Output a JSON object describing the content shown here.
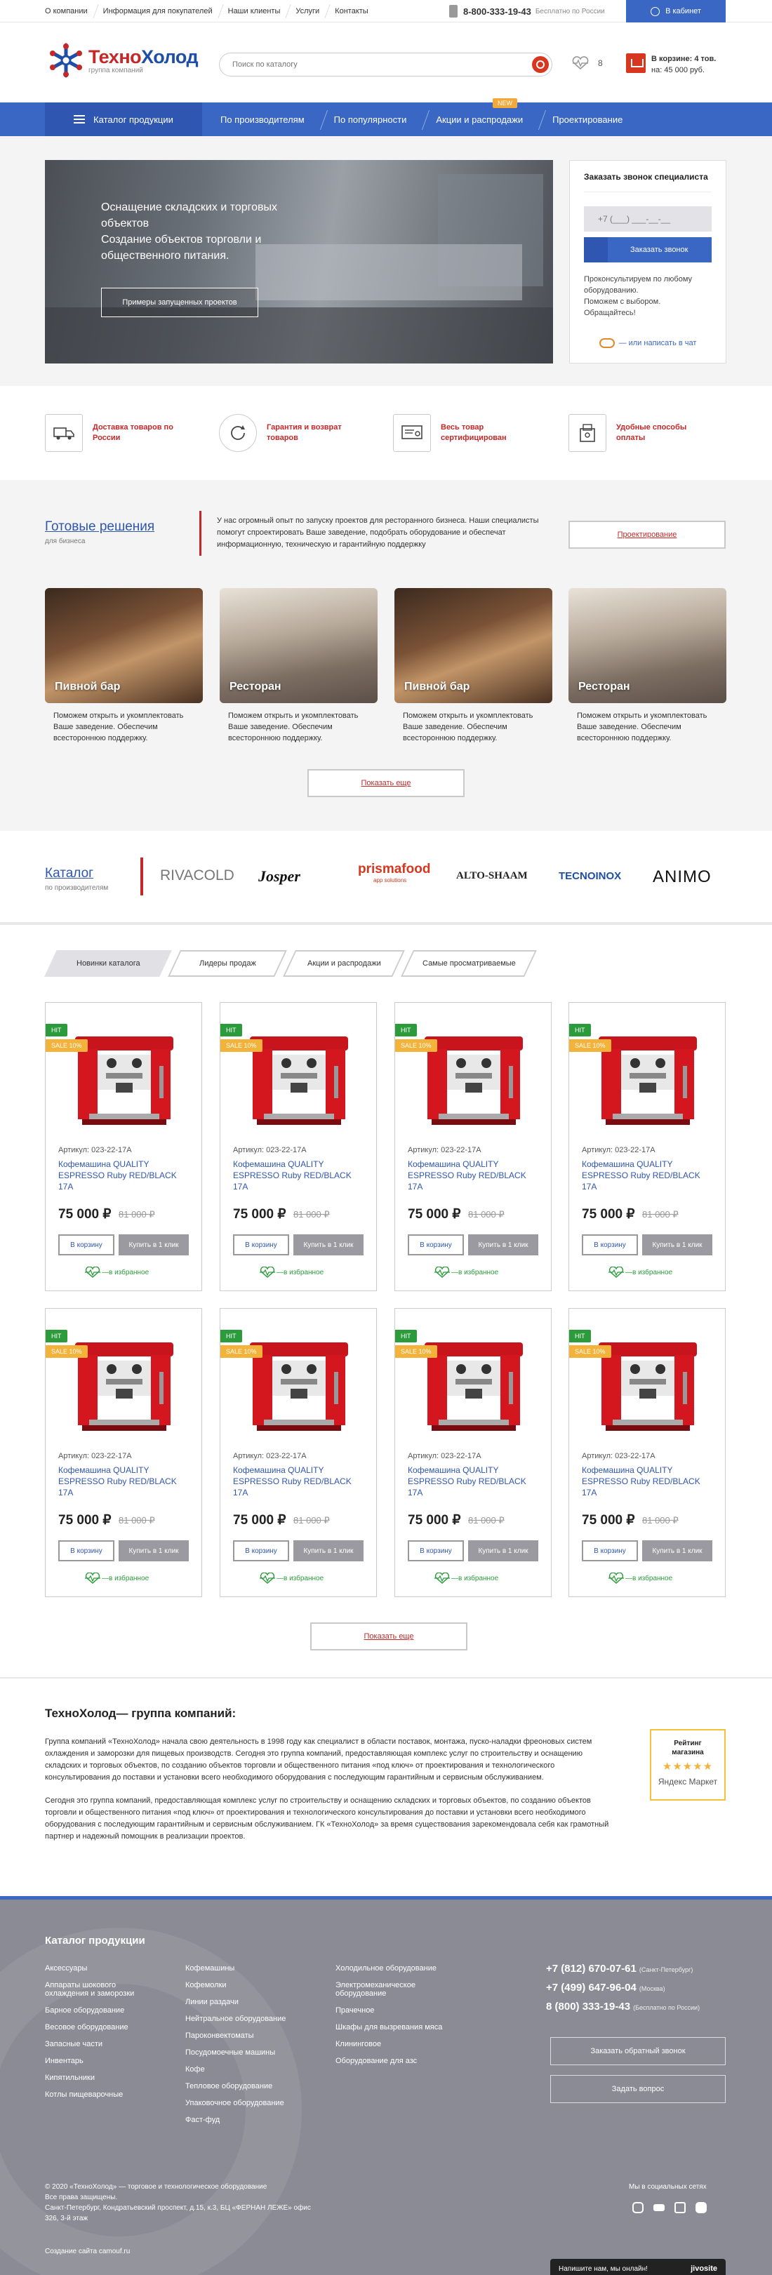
{
  "topnav": {
    "items": [
      "О компании",
      "Информация для покупателей",
      "Наши клиенты",
      "Услуги",
      "Контакты"
    ],
    "phone": "8-800-333-19-43",
    "phone_note": "Бесплатно по России",
    "cabinet": "В кабинет"
  },
  "header": {
    "logo_title_a": "Техно",
    "logo_title_b": "Холод",
    "logo_sub": "группа компаний",
    "search_placeholder": "Поиск по каталогу",
    "fav_count": "8",
    "cart_line1": "В корзине: 4 тов.",
    "cart_line2": "на: 45 000 руб."
  },
  "nav": {
    "catalog": "Каталог продукции",
    "items": [
      "По производителям",
      "По популярности",
      "Акции и распродажи",
      "Проектирование"
    ],
    "badge": "NEW"
  },
  "hero": {
    "title": "Оснащение складских и торговых объектов\nСоздание объектов торговли и общественного питания.",
    "button": "Примеры запущенных проектов"
  },
  "callback": {
    "title": "Заказать звонок специалиста",
    "phone_placeholder": "+7 (___) ___-__-__",
    "button": "Заказать звонок",
    "text": "Проконсультируем по любому оборудованию.\nПоможем с выбором. Обращайтесь!",
    "chat": "— или написать в чат"
  },
  "features": [
    "Доставка товаров по России",
    "Гарантия и возврат товаров",
    "Весь товар сертифицирован",
    "Удобные способы оплаты"
  ],
  "solutions": {
    "title": "Готовые решения",
    "subtitle": "для бизнеса",
    "desc": "У нас огромный опыт по запуску проектов для ресторанного бизнеса. Наши специалисты помогут спроектировать Ваше заведение, подобрать оборудование и обеспечат информационную, техническую и гарантийную поддержку",
    "button": "Проектирование",
    "cards": [
      {
        "name": "Пивной бар",
        "text": "Поможем открыть и укомплектовать Ваше заведение. Обеспечим всестороннюю поддержку."
      },
      {
        "name": "Ресторан",
        "text": "Поможем открыть и укомплектовать Ваше заведение. Обеспечим всестороннюю поддержку."
      },
      {
        "name": "Пивной бар",
        "text": "Поможем открыть и укомплектовать Ваше заведение. Обеспечим всестороннюю поддержку."
      },
      {
        "name": "Ресторан",
        "text": "Поможем открыть и укомплектовать Ваше заведение. Обеспечим всестороннюю поддержку."
      }
    ],
    "more": "Показать еще"
  },
  "brands": {
    "title": "Каталог",
    "subtitle": "по производителям",
    "items": [
      "RIVACOLD",
      "Josper",
      "prismafood",
      "ALTO-SHAAM",
      "TECNOINOX",
      "ANIMO"
    ],
    "prisma_tagline": "app solutions"
  },
  "tabs": [
    "Новинки каталога",
    "Лидеры продаж",
    "Акции и распродажи",
    "Самые просматриваемые"
  ],
  "product": {
    "hit": "HIT",
    "sale": "SALE 10%",
    "article": "Артикул: 023-22-17А",
    "name": "Кофемашина QUALITY ESPRESSO Ruby RED/BLACK 17A",
    "price": "75 000 ₽",
    "old_price": "81 000 ₽",
    "to_cart": "В корзину",
    "one_click": "Купить в 1 клик",
    "fav": "в избранное"
  },
  "more2": "Показать еще",
  "about": {
    "title": "ТехноХолод— группа компаний:",
    "p1": "Группа компаний «ТехноХолод» начала свою деятельность в 1998 году как специалист в области поставок, монтажа, пуско-наладки фреоновых систем охлаждения и заморозки для пищевых производств. Сегодня это группа компаний, предоставляющая комплекс услуг по строительству и оснащению складских и торговых объектов, по созданию объектов торговли и общественного питания «под ключ» от проектирования и технологического консультирования до поставки и установки всего необходимого оборудования с последующим гарантийным и сервисным обслуживанием.",
    "p2": "Сегодня это группа компаний, предоставляющая комплекс услуг по строительству и оснащению складских и торговых объектов, по созданию объектов торговли и общественного питания «под ключ» от проектирования и технологического консультирования до поставки и установки всего необходимого оборудования с последующим гарантийным и сервисным обслуживанием. ГК «ТехноХолод» за время существования зарекомендовала себя как грамотный партнер и надежный помощник в реализации проектов.",
    "rating1": "Рейтинг",
    "rating2": "магазина",
    "stars": "★★★★★",
    "market": "Яндекс Маркет"
  },
  "footer": {
    "title": "Катaлог продукции",
    "col1": [
      "Аксессуары",
      "Аппараты шокового охлаждения и заморозки",
      "Барное оборудование",
      "Весовое оборудование",
      "Запасные части",
      "Инвентарь",
      "Кипятильники",
      "Котлы пищеварочные"
    ],
    "col2": [
      "Кофемашины",
      "Кофемолки",
      "Линии раздачи",
      "Нейтральное оборудование",
      "Пароконвектоматы",
      "Посудомоечные машины",
      "Кофе",
      "Тепловое оборудование",
      "Упаковочное оборудование",
      "Фаст-фуд"
    ],
    "col3": [
      "Холодильное оборудование",
      "Электромеханическое оборудование",
      "Прачечное",
      "Шкафы для вызревания мяса",
      "Клининговое",
      "Оборудование для азс"
    ],
    "phones": [
      {
        "num": "+7 (812) 670-07-61",
        "city": "(Санкт-Петербург)"
      },
      {
        "num": "+7 (499) 647-96-04",
        "city": "(Москва)"
      },
      {
        "num": "8 (800) 333-19-43",
        "city": "(Бесплатно по России)"
      }
    ],
    "btn1": "Заказать обратный звонок",
    "btn2": "Задать вопрос",
    "copy": "© 2020 «ТехноХолод» — торговое и технологическое оборудование\nВсе права защищены.\nСанкт-Петербург, Кондратьевский проспект, д.15, к.3, БЦ «ФЕРНАН ЛЕЖЕ» офис 326, 3-й этаж",
    "dev": "Создание сайта camouf.ru",
    "social": "Мы в социальных сетях",
    "chat_text": "Напишите нам, мы онлайн!",
    "chat_brand": "jivosite"
  }
}
